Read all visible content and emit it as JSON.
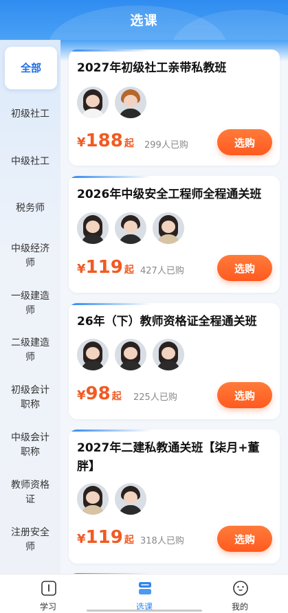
{
  "header": {
    "title": "选课"
  },
  "sidebar": {
    "items": [
      {
        "label": "全部",
        "active": true
      },
      {
        "label": "初级社工"
      },
      {
        "label": "中级社工"
      },
      {
        "label": "税务师"
      },
      {
        "label": "中级经济师"
      },
      {
        "label": "一级建造师"
      },
      {
        "label": "二级建造师"
      },
      {
        "label": "初级会计职称"
      },
      {
        "label": "中级会计职称"
      },
      {
        "label": "教师资格证"
      },
      {
        "label": "注册安全师"
      }
    ]
  },
  "courses": [
    {
      "name": "2027年初级社工亲带私教班",
      "currency": "¥",
      "price": "188",
      "suffix": "起",
      "sold": "299人已购",
      "button": "选购"
    },
    {
      "name": "2026年中级安全工程师全程通关班",
      "currency": "¥",
      "price": "119",
      "suffix": "起",
      "sold": "427人已购",
      "button": "选购"
    },
    {
      "name": "26年（下）教师资格证全程通关班",
      "currency": "¥",
      "price": "98",
      "suffix": "起",
      "sold": "225人已购",
      "button": "选购"
    },
    {
      "name": "2027年二建私教通关班【柒月+董胖】",
      "currency": "¥",
      "price": "119",
      "suffix": "起",
      "sold": "318人已购",
      "button": "选购"
    }
  ],
  "tabbar": {
    "items": [
      {
        "label": "学习",
        "icon": "book-icon"
      },
      {
        "label": "选课",
        "icon": "course-stack-icon",
        "active": true
      },
      {
        "label": "我的",
        "icon": "smiley-face-icon"
      }
    ]
  },
  "colors": {
    "accent": "#2e86f0",
    "price": "#f15a22",
    "button": "#ff6a2a"
  }
}
